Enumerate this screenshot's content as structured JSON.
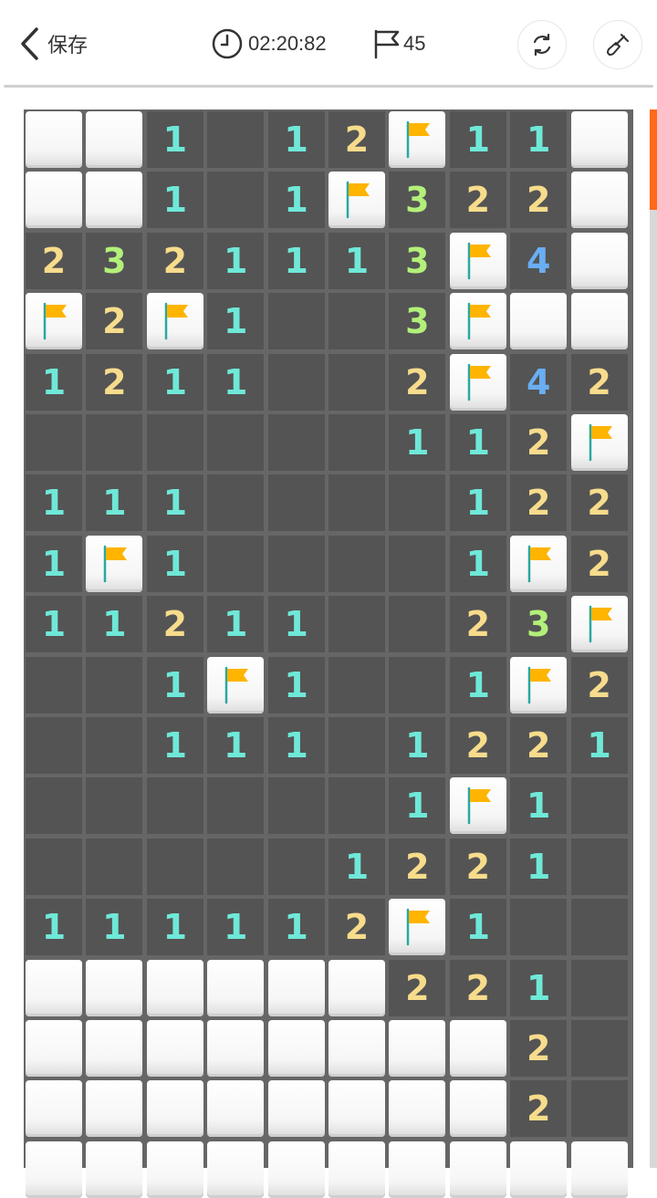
{
  "header": {
    "back_label": "保存",
    "timer": "02:20:82",
    "flag_count": "45"
  },
  "colors": {
    "1": "#6fe8d8",
    "2": "#f7dc8c",
    "3": "#b3f07a",
    "4": "#6aaef2",
    "flag": "#ffb400",
    "accent": "#ff6a1a"
  },
  "board": {
    "rows": [
      [
        "#",
        "#",
        "1",
        "",
        "1",
        "2",
        "F",
        "1",
        "1",
        "#"
      ],
      [
        "#",
        "#",
        "1",
        "",
        "1",
        "F",
        "3",
        "2",
        "2",
        "#"
      ],
      [
        "2",
        "3",
        "2",
        "1",
        "1",
        "1",
        "3",
        "F",
        "4",
        "#"
      ],
      [
        "F",
        "2",
        "F",
        "1",
        "",
        "",
        "3",
        "F",
        "#",
        "#"
      ],
      [
        "1",
        "2",
        "1",
        "1",
        "",
        "",
        "2",
        "F",
        "4",
        "2"
      ],
      [
        "",
        "",
        "",
        "",
        "",
        "",
        "1",
        "1",
        "2",
        "F"
      ],
      [
        "1",
        "1",
        "1",
        "",
        "",
        "",
        "",
        "1",
        "2",
        "2"
      ],
      [
        "1",
        "F",
        "1",
        "",
        "",
        "",
        "",
        "1",
        "F",
        "2"
      ],
      [
        "1",
        "1",
        "2",
        "1",
        "1",
        "",
        "",
        "2",
        "3",
        "F"
      ],
      [
        "",
        "",
        "1",
        "F",
        "1",
        "",
        "",
        "1",
        "F",
        "2"
      ],
      [
        "",
        "",
        "1",
        "1",
        "1",
        "",
        "1",
        "2",
        "2",
        "1"
      ],
      [
        "",
        "",
        "",
        "",
        "",
        "",
        "1",
        "F",
        "1",
        ""
      ],
      [
        "",
        "",
        "",
        "",
        "",
        "1",
        "2",
        "2",
        "1",
        ""
      ],
      [
        "1",
        "1",
        "1",
        "1",
        "1",
        "2",
        "F",
        "1",
        "",
        ""
      ],
      [
        "#",
        "#",
        "#",
        "#",
        "#",
        "#",
        "2",
        "2",
        "1",
        ""
      ],
      [
        "#",
        "#",
        "#",
        "#",
        "#",
        "#",
        "#",
        "#",
        "2",
        ""
      ],
      [
        "#",
        "#",
        "#",
        "#",
        "#",
        "#",
        "#",
        "#",
        "2",
        ""
      ],
      [
        "#",
        "#",
        "#",
        "#",
        "#",
        "#",
        "#",
        "#",
        "#",
        "#"
      ]
    ]
  }
}
